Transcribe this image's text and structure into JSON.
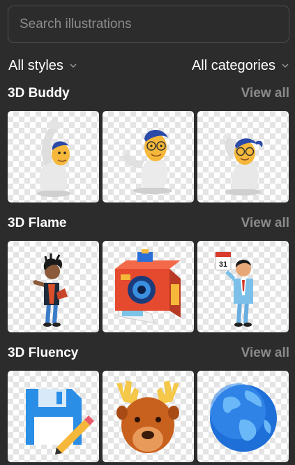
{
  "search": {
    "placeholder": "Search illustrations",
    "value": ""
  },
  "filters": {
    "styles_label": "All styles",
    "categories_label": "All categories"
  },
  "sections": [
    {
      "title": "3D Buddy",
      "view_all": "View all",
      "items": [
        {
          "icon": "buddy-waving-icon"
        },
        {
          "icon": "buddy-thumbs-up-icon"
        },
        {
          "icon": "buddy-peeking-icon"
        }
      ]
    },
    {
      "title": "3D Flame",
      "view_all": "View all",
      "items": [
        {
          "icon": "guitarist-icon"
        },
        {
          "icon": "instant-camera-icon"
        },
        {
          "icon": "businessman-calendar-icon"
        }
      ]
    },
    {
      "title": "3D Fluency",
      "view_all": "View all",
      "items": [
        {
          "icon": "floppy-disk-edit-icon"
        },
        {
          "icon": "moose-icon"
        },
        {
          "icon": "globe-icon"
        }
      ],
      "calendar_day": "31"
    }
  ],
  "colors": {
    "background": "#2c2c2c",
    "muted": "#8a8a8a",
    "placeholder": "#8c8c8c",
    "border": "#4d4d4d"
  }
}
